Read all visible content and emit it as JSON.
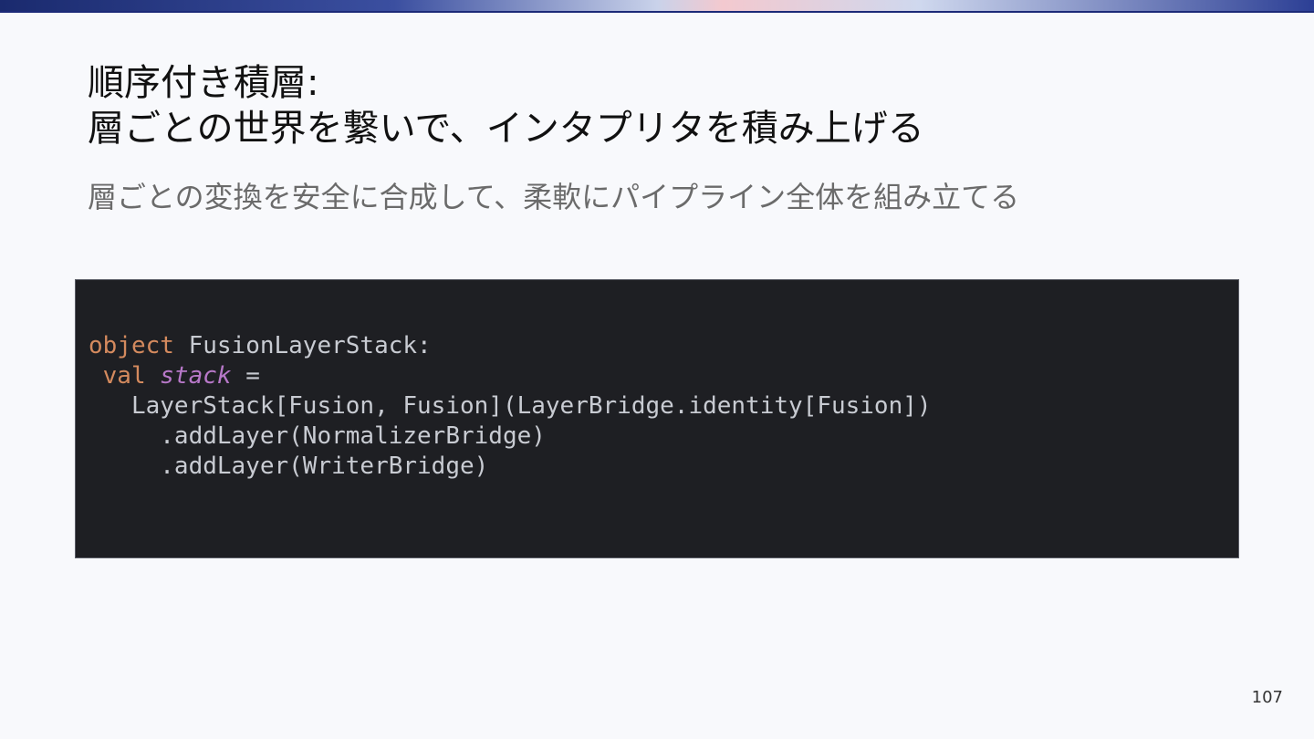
{
  "slide": {
    "title_line1": "順序付き積層:",
    "title_line2": "層ごとの世界を繋いで、インタプリタを積み上げる",
    "subtitle": "層ごとの変換を安全に合成して、柔軟にパイプライン全体を組み立てる",
    "page_number": "107"
  },
  "code": {
    "line1_keyword": "object",
    "line1_rest": " FusionLayerStack:",
    "line2_indent": " ",
    "line2_keyword": "val",
    "line2_space": " ",
    "line2_name": "stack",
    "line2_rest": " =",
    "line3": "   LayerStack[Fusion, Fusion](LayerBridge.identity[Fusion])",
    "line4": "     .addLayer(NormalizerBridge)",
    "line5": "     .addLayer(WriterBridge)"
  },
  "colors": {
    "background": "#f8f9fc",
    "code_background": "#1e1f23",
    "code_text": "#c8cbd2",
    "keyword": "#d48a5e",
    "identifier_italic": "#b778c8",
    "subtitle_text": "#6b6b6b",
    "accent_bar": "#1c2a78"
  }
}
